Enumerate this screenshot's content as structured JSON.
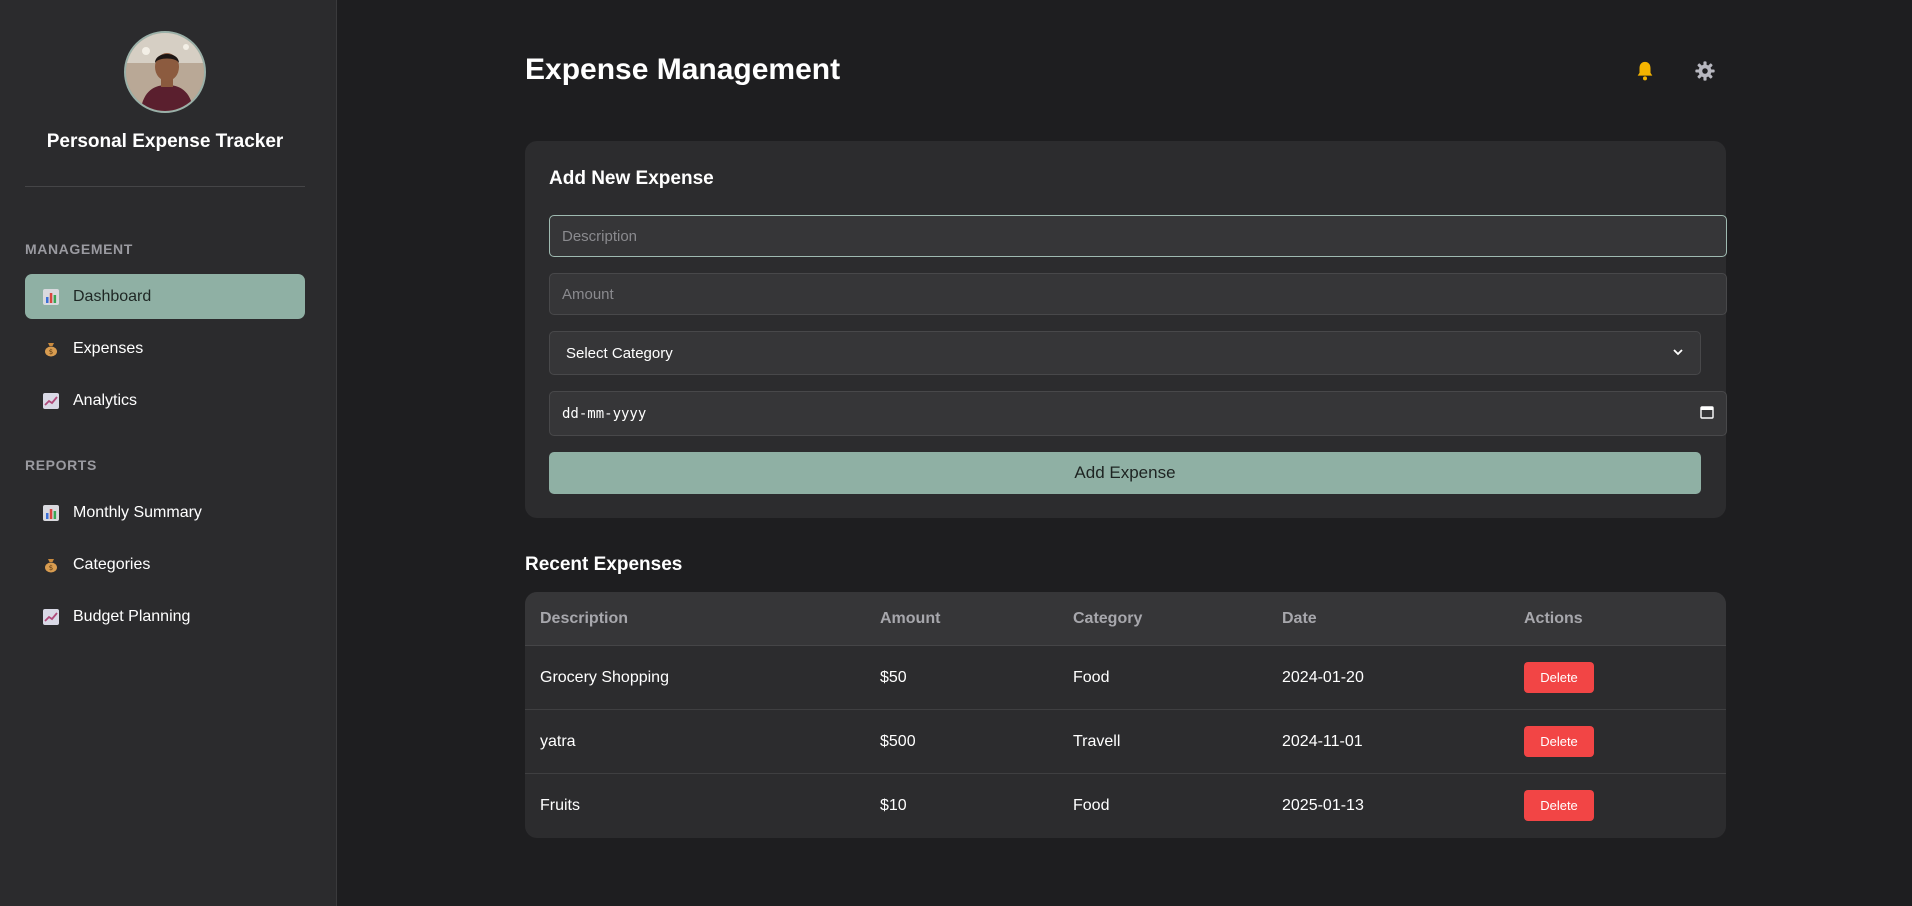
{
  "sidebar": {
    "app_title": "Personal Expense Tracker",
    "sections": [
      {
        "label": "MANAGEMENT",
        "items": [
          {
            "label": "Dashboard",
            "icon": "bar-chart-icon",
            "active": true
          },
          {
            "label": "Expenses",
            "icon": "money-bag-icon",
            "active": false
          },
          {
            "label": "Analytics",
            "icon": "trend-chart-icon",
            "active": false
          }
        ]
      },
      {
        "label": "REPORTS",
        "items": [
          {
            "label": "Monthly Summary",
            "icon": "bar-chart-icon",
            "active": false
          },
          {
            "label": "Categories",
            "icon": "money-bag-icon",
            "active": false
          },
          {
            "label": "Budget Planning",
            "icon": "trend-chart-icon",
            "active": false
          }
        ]
      }
    ]
  },
  "header": {
    "title": "Expense Management",
    "icons": [
      "bell-icon",
      "gear-icon"
    ]
  },
  "form": {
    "title": "Add New Expense",
    "description_placeholder": "Description",
    "amount_placeholder": "Amount",
    "category_selected": "Select Category",
    "date_placeholder": "dd-mm-yyyy",
    "submit_label": "Add Expense"
  },
  "recent": {
    "title": "Recent Expenses",
    "columns": [
      "Description",
      "Amount",
      "Category",
      "Date",
      "Actions"
    ],
    "rows": [
      {
        "description": "Grocery Shopping",
        "amount": "$50",
        "category": "Food",
        "date": "2024-01-20",
        "action": "Delete"
      },
      {
        "description": "yatra",
        "amount": "$500",
        "category": "Travell",
        "date": "2024-11-01",
        "action": "Delete"
      },
      {
        "description": "Fruits",
        "amount": "$10",
        "category": "Food",
        "date": "2025-01-13",
        "action": "Delete"
      }
    ]
  },
  "colors": {
    "accent": "#8fb0a4",
    "delete": "#f24545",
    "bell": "#f5b400",
    "background": "#1e1e20",
    "panel": "#2c2c2e"
  }
}
